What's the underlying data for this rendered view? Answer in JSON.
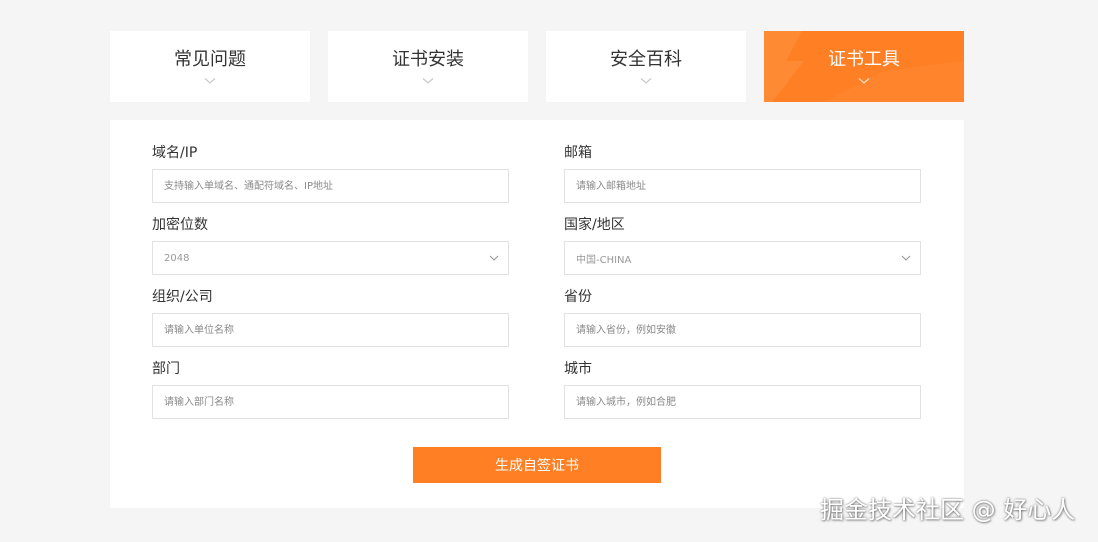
{
  "tabs": [
    {
      "label": "常见问题",
      "active": false
    },
    {
      "label": "证书安装",
      "active": false
    },
    {
      "label": "安全百科",
      "active": false
    },
    {
      "label": "证书工具",
      "active": true
    }
  ],
  "form": {
    "domain": {
      "label": "域名/IP",
      "placeholder": "支持输入单域名、通配符域名、IP地址"
    },
    "email": {
      "label": "邮箱",
      "placeholder": "请输入邮箱地址"
    },
    "key_size": {
      "label": "加密位数",
      "value": "2048"
    },
    "country": {
      "label": "国家/地区",
      "value": "中国-CHINA"
    },
    "organization": {
      "label": "组织/公司",
      "placeholder": "请输入单位名称"
    },
    "province": {
      "label": "省份",
      "placeholder": "请输入省份，例如安徽"
    },
    "department": {
      "label": "部门",
      "placeholder": "请输入部门名称"
    },
    "city": {
      "label": "城市",
      "placeholder": "请输入城市，例如合肥"
    },
    "submit_label": "生成自签证书"
  },
  "watermark": "掘金技术社区 @ 好心人",
  "colors": {
    "accent": "#ff7f24",
    "background": "#f5f5f5",
    "panel": "#ffffff",
    "border": "#e1e1e1"
  },
  "icons": {
    "tab_chevron": "chevron-down-icon",
    "select_caret": "caret-down-icon"
  }
}
